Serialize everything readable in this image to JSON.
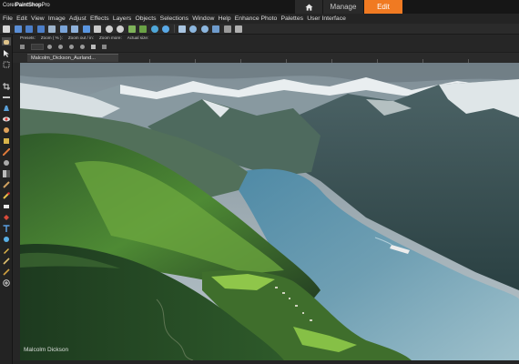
{
  "app": {
    "logo_prefix": "Corel",
    "logo_name": "PaintShop",
    "logo_suffix": "Pro"
  },
  "workspace_tabs": {
    "manage": "Manage",
    "edit": "Edit"
  },
  "menu": [
    "File",
    "Edit",
    "View",
    "Image",
    "Adjust",
    "Effects",
    "Layers",
    "Objects",
    "Selections",
    "Window",
    "Help",
    "Enhance Photo",
    "Palettes",
    "User Interface"
  ],
  "tool_options": {
    "presets_label": "Presets:",
    "zoom_label": "Zoom ( % ):",
    "zoom_out_label": "Zoom out / in:",
    "zoom_more_label": "Zoom more:",
    "actual_size_label": "Actual size:"
  },
  "document": {
    "tab_title": "Malcolm_Dickson_Aurland..."
  },
  "canvas": {
    "watermark": "Malcolm Dickson"
  },
  "colors": {
    "accent": "#f07a22"
  }
}
